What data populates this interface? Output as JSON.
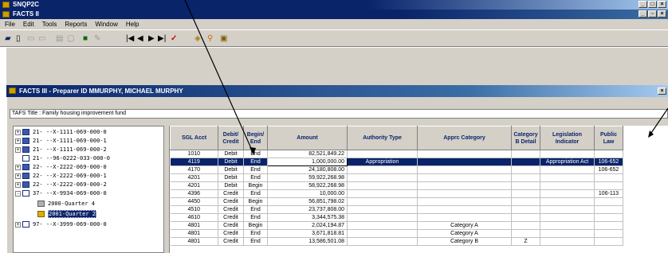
{
  "app": {
    "title": "SNQP2C",
    "window_title": "FACTS II"
  },
  "menu": [
    "File",
    "Edit",
    "Tools",
    "Reports",
    "Window",
    "Help"
  ],
  "child": {
    "title": "FACTS III - Preparer ID MMURPHY, MICHAEL MURPHY",
    "tas_title": "TAFS Title : Family housing improvement fund"
  },
  "tree": [
    {
      "label": "21-  --X-1111-069-000-0",
      "expander": "+"
    },
    {
      "label": "21-  --X-1111-069-000-1",
      "expander": "+"
    },
    {
      "label": "21-  --X-1111-069-000-2",
      "expander": "+"
    },
    {
      "label": "21-  --96-0222-033-000-0",
      "expander": ""
    },
    {
      "label": "22-  --X-2222-069-000-0",
      "expander": "+"
    },
    {
      "label": "22-  --X-2222-069-000-1",
      "expander": "+"
    },
    {
      "label": "22-  --X-2222-069-000-2",
      "expander": "+"
    },
    {
      "label": "37-  --X-9934-069-000-0",
      "expander": "-"
    },
    {
      "label": "2000-Quarter 4",
      "expander": ""
    },
    {
      "label": "2001-Quarter 2",
      "expander": "",
      "selected": true
    },
    {
      "label": "97-  --X-3999-069-000-0",
      "expander": "+"
    }
  ],
  "grid": {
    "columns": [
      "SGL Acct",
      "Debit/ Credit",
      "Begin/ End",
      "Amount",
      "Authority Type",
      "Apprc Category",
      "Category B Detail",
      "Legislation Indicator",
      "Public Law"
    ],
    "rows": [
      [
        "1010",
        "Debit",
        "End",
        "82,521,849.22",
        "",
        "",
        "",
        "",
        ""
      ],
      [
        "4119",
        "Debit",
        "End",
        "1,000,000.00",
        "Appropriation",
        "",
        "",
        "Appropriation Act",
        "106-652"
      ],
      [
        "4170",
        "Debit",
        "End",
        "24,180,808.00",
        "",
        "",
        "",
        "",
        "106-652"
      ],
      [
        "4201",
        "Debit",
        "End",
        "59,922,268.98",
        "",
        "",
        "",
        "",
        ""
      ],
      [
        "4201",
        "Debit",
        "Begin",
        "58,922,268.98",
        "",
        "",
        "",
        "",
        ""
      ],
      [
        "4396",
        "Credit",
        "End",
        "10,000.00",
        "",
        "",
        "",
        "",
        "106-113"
      ],
      [
        "4450",
        "Credit",
        "Begin",
        "56,851,798.02",
        "",
        "",
        "",
        "",
        ""
      ],
      [
        "4510",
        "Credit",
        "End",
        "23,737,808.00",
        "",
        "",
        "",
        "",
        ""
      ],
      [
        "4610",
        "Credit",
        "End",
        "3,344,575.38",
        "",
        "",
        "",
        "",
        ""
      ],
      [
        "4801",
        "Credit",
        "Begin",
        "2,024,194.87",
        "",
        "Category A",
        "",
        "",
        ""
      ],
      [
        "4801",
        "Credit",
        "End",
        "3,671,818.81",
        "",
        "Category A",
        "",
        "",
        ""
      ],
      [
        "4801",
        "Credit",
        "End",
        "13,586,501.08",
        "",
        "Category B",
        "Z",
        "",
        ""
      ]
    ],
    "highlighted_row": 1
  }
}
